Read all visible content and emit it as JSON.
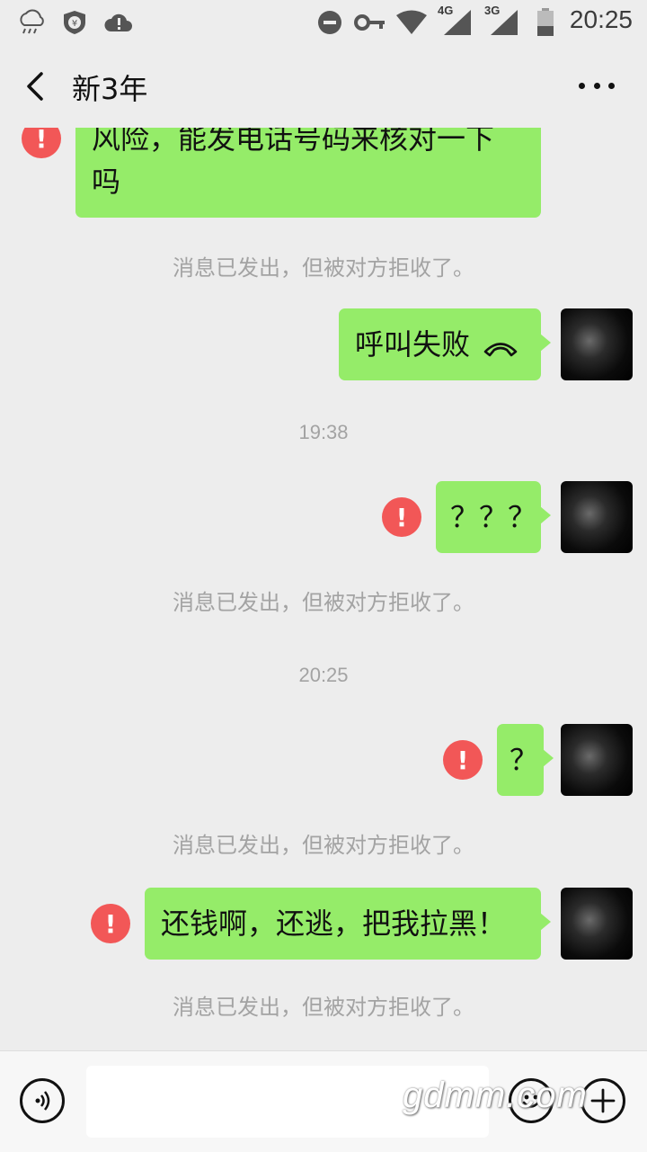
{
  "status_bar": {
    "time": "20:25",
    "network_1": "4G",
    "network_2": "3G",
    "icons": [
      "cloud-rain-icon",
      "shield-yen-icon",
      "cloud-alert-icon",
      "do-not-disturb-icon",
      "key-icon",
      "wifi-icon",
      "signal-4g-icon",
      "signal-3g-icon",
      "battery-icon"
    ]
  },
  "header": {
    "title": "新3年",
    "back_icon": "back-chevron-icon",
    "more_icon": "more-dots-icon"
  },
  "messages": {
    "m1": {
      "text_line1": "风险，能发电话号码来核对一下",
      "text_line2": "吗"
    },
    "sys1": "消息已发出，但被对方拒收了。",
    "m2": {
      "text": "呼叫失败",
      "icon": "hangup-phone-icon"
    },
    "ts1": "19:38",
    "m3": {
      "text": "？？？"
    },
    "sys2": "消息已发出，但被对方拒收了。",
    "ts2": "20:25",
    "m4": {
      "text": "？"
    },
    "sys3": "消息已发出，但被对方拒收了。",
    "m5": {
      "text": "还钱啊，还逃，把我拉黑！"
    },
    "sys4": "消息已发出，但被对方拒收了。",
    "error_mark": "!"
  },
  "input_bar": {
    "voice_icon": "voice-input-icon",
    "emoji_icon": "emoji-icon",
    "plus_icon": "plus-icon",
    "input_value": ""
  },
  "watermark": "gdmm.com",
  "colors": {
    "bubble_green": "#95ec69",
    "error_red": "#f25757",
    "background": "#ededed",
    "system_text": "#a3a3a3"
  }
}
